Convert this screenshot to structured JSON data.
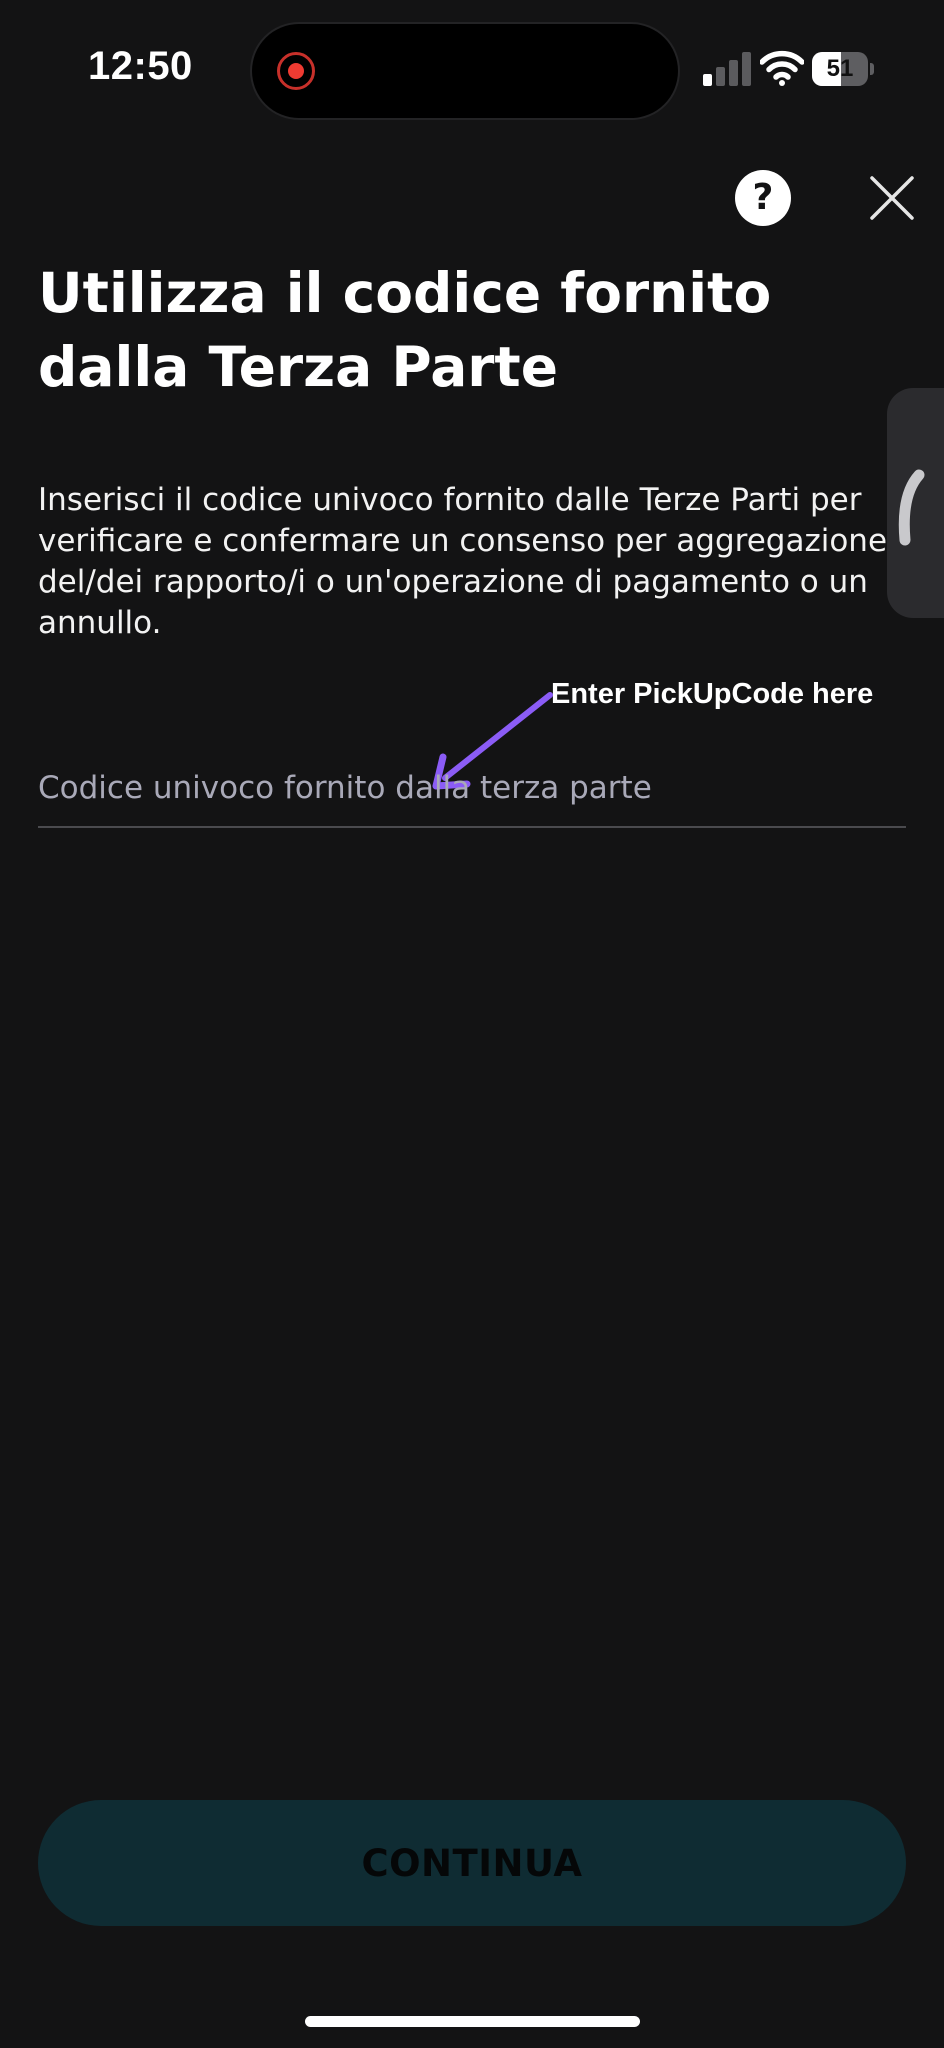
{
  "status_bar": {
    "time": "12:50",
    "battery": "51",
    "battery_level": 0.51,
    "signal_bars_active": 1,
    "signal_bars_total": 4,
    "recording": true
  },
  "header": {
    "help_label": "?",
    "help_icon": "question-icon",
    "close_icon": "close-icon"
  },
  "main": {
    "title": "Utilizza il codice fornito dalla Terza Parte",
    "description": "Inserisci il codice univoco fornito dalle Terze Parti per verificare e confermare un consenso per aggregazione del/dei rapporto/i o un'operazione di pagamento o un annullo.",
    "annotation": "Enter PickUpCode here",
    "code_input": {
      "value": "",
      "placeholder": "Codice univoco fornito dalla terza parte"
    }
  },
  "side_handle": {
    "icon": "chevron-left-icon"
  },
  "footer": {
    "continue_label": "CONTINUA"
  },
  "colors": {
    "background": "#131314",
    "button_background": "#0f2c33",
    "annotation_arrow": "#8b5cf6",
    "record_indicator": "#ef3b32"
  }
}
